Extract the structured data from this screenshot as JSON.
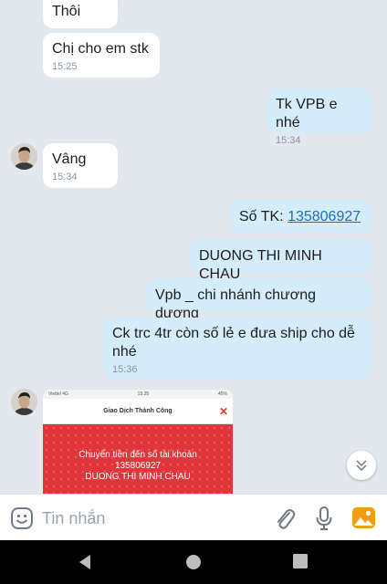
{
  "messages": [
    {
      "text": "Thôi"
    },
    {
      "text": "Chị cho em stk",
      "time": "15:25"
    },
    {
      "text": "Tk VPB e nhé",
      "time": "15:34"
    },
    {
      "text": "Vâng",
      "time": "15:34"
    },
    {
      "prefix": "Số TK: ",
      "link": "135806927"
    },
    {
      "text": "DUONG THI MINH CHAU"
    },
    {
      "text": "Vpb _ chi nhánh chương dương"
    },
    {
      "line1": "Ck trc 4tr còn số lẻ e đưa ship cho dễ",
      "line2": "nhé",
      "time": "15:36"
    }
  ],
  "receipt": {
    "status_left": "Viettel  4G",
    "status_time": "15:35",
    "status_right": "45%",
    "header": "Giao Dịch Thành Công",
    "line1": "Chuyển tiền đến số tài khoản",
    "line2": "135806927",
    "line3": "DUONG THI MINH CHAU"
  },
  "composer": {
    "placeholder": "Tin nhắn"
  },
  "colors": {
    "incoming": "#ffffff",
    "outgoing": "#d5ecfb",
    "link": "#1a6fc0",
    "accent_orange": "#f39c12",
    "receipt_red": "#e0353a"
  },
  "icons": [
    "emoji-icon",
    "attach-icon",
    "mic-icon",
    "gallery-icon",
    "chevron-down-icon",
    "back-icon",
    "home-icon",
    "recents-icon"
  ]
}
